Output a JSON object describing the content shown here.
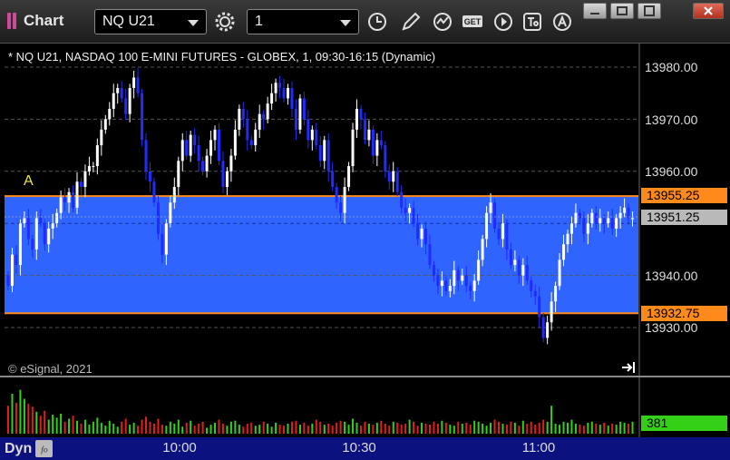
{
  "app": {
    "title": "Chart"
  },
  "toolbar": {
    "symbol": "NQ U21",
    "interval": "1",
    "buttons": [
      "settings-gear-icon",
      "clock-icon",
      "pencil-icon",
      "chart-style-icon",
      "get-icon",
      "play-icon",
      "text-tool-icon",
      "alert-icon"
    ],
    "get_label": "GET"
  },
  "chart": {
    "title": "* NQ U21, NASDAQ 100 E-MINI FUTURES - GLOBEX, 1, 09:30-16:15 (Dynamic)",
    "copyright": "© eSignal, 2021",
    "draw_label": "A",
    "price_ticks": [
      "13980.00",
      "13970.00",
      "13960.00",
      "13940.00",
      "13930.00"
    ],
    "time_ticks": [
      "10:00",
      "10:30",
      "11:00"
    ],
    "labels": {
      "upper": "13955.25",
      "last": "13951.25",
      "lower": "13932.75",
      "volume": "381"
    },
    "dyn_label": "Dyn",
    "colors": {
      "band": "#2f64ff",
      "band_line": "#ff8a1c",
      "up": "#ffffff",
      "down": "#1f2bff",
      "last": "#b9b9b9",
      "volume": "#33d017"
    }
  },
  "chart_data": {
    "type": "candlestick",
    "title": "* NQ U21, NASDAQ 100 E-MINI FUTURES - GLOBEX, 1, 09:30-16:15 (Dynamic)",
    "ylim": [
      13926,
      13987
    ],
    "y_ticks": [
      13930,
      13940,
      13960,
      13970,
      13980
    ],
    "x_ticks": [
      "10:00",
      "10:30",
      "11:00"
    ],
    "band": {
      "upper": 13955.25,
      "lower": 13932.75
    },
    "last_price": 13951.25,
    "last_volume": 381,
    "close": [
      13938,
      13944,
      13942,
      13950,
      13951,
      13947,
      13945,
      13951,
      13950,
      13946,
      13949,
      13950,
      13952,
      13955,
      13954,
      13956,
      13953,
      13958,
      13957,
      13960,
      13961,
      13961,
      13965,
      13968,
      13970,
      13972,
      13975,
      13976,
      13974,
      13971,
      13976,
      13978,
      13975,
      13966,
      13960,
      13958,
      13954,
      13948,
      13944,
      13950,
      13954,
      13957,
      13962,
      13966,
      13963,
      13967,
      13965,
      13962,
      13960,
      13963,
      13966,
      13968,
      13962,
      13957,
      13960,
      13963,
      13968,
      13972,
      13970,
      13966,
      13965,
      13968,
      13971,
      13970,
      13973,
      13975,
      13977,
      13976,
      13974,
      13976,
      13972,
      13968,
      13974,
      13970,
      13966,
      13968,
      13965,
      13962,
      13966,
      13960,
      13957,
      13954,
      13952,
      13957,
      13961,
      13968,
      13972,
      13970,
      13966,
      13968,
      13963,
      13966,
      13965,
      13960,
      13958,
      13960,
      13956,
      13953,
      13952,
      13953,
      13950,
      13947,
      13949,
      13946,
      13942,
      13940,
      13938,
      13939,
      13937,
      13938,
      13941,
      13939,
      13940,
      13938,
      13937,
      13939,
      13943,
      13947,
      13952,
      13954,
      13949,
      13947,
      13950,
      13945,
      13942,
      13943,
      13940,
      13942,
      13939,
      13937,
      13936,
      13932,
      13928,
      13931,
      13935,
      13938,
      13943,
      13946,
      13948,
      13950,
      13952,
      13951,
      13948,
      13950,
      13952,
      13950,
      13951,
      13950,
      13951,
      13949,
      13951,
      13952,
      13953,
      13951,
      13951
    ],
    "volume": [
      28,
      40,
      31,
      44,
      35,
      30,
      27,
      22,
      18,
      23,
      14,
      19,
      16,
      20,
      12,
      15,
      18,
      13,
      10,
      14,
      9,
      12,
      16,
      11,
      8,
      13,
      10,
      7,
      12,
      15,
      9,
      11,
      8,
      14,
      17,
      12,
      10,
      15,
      9,
      8,
      12,
      10,
      14,
      7,
      11,
      13,
      8,
      10,
      12,
      6,
      9,
      11,
      14,
      10,
      8,
      12,
      13,
      9,
      7,
      10,
      11,
      8,
      9,
      12,
      10,
      7,
      11,
      9,
      8,
      10,
      12,
      13,
      9,
      11,
      8,
      10,
      14,
      12,
      9,
      10,
      8,
      11,
      13,
      12,
      9,
      15,
      11,
      8,
      12,
      10,
      9,
      11,
      13,
      10,
      8,
      12,
      11,
      9,
      10,
      14,
      12,
      8,
      11,
      10,
      9,
      12,
      10,
      13,
      11,
      9,
      8,
      12,
      10,
      11,
      9,
      13,
      12,
      10,
      8,
      11,
      14,
      12,
      10,
      9,
      12,
      11,
      8,
      13,
      10,
      12,
      9,
      11,
      14,
      12,
      28,
      10,
      9,
      12,
      11,
      14,
      10,
      9,
      8,
      11,
      12,
      10,
      9,
      11,
      8,
      10,
      9,
      12,
      11,
      10,
      12
    ]
  }
}
